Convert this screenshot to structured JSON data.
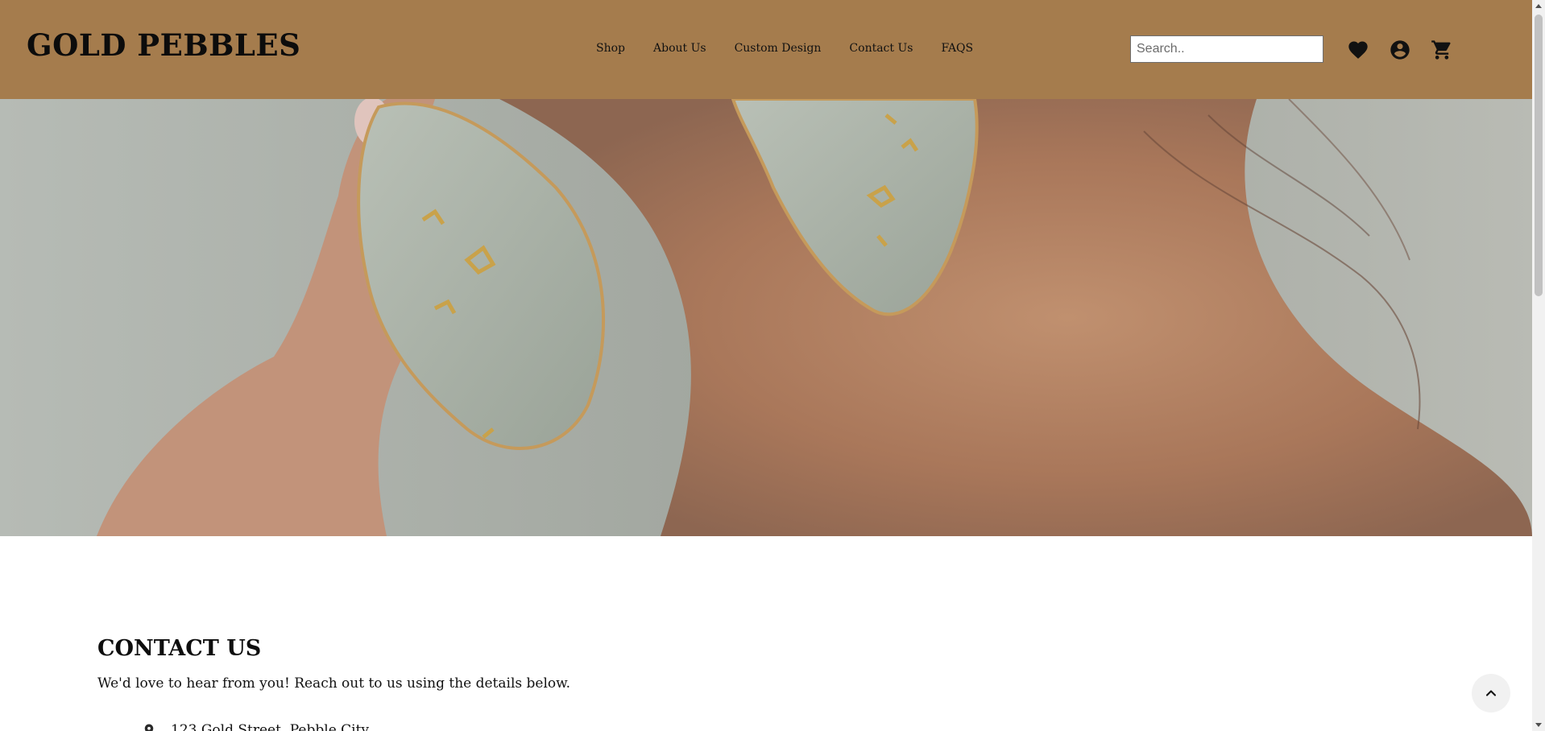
{
  "brand": {
    "name": "GOLD PEBBLES"
  },
  "nav": {
    "items": [
      {
        "label": "Shop"
      },
      {
        "label": "About Us"
      },
      {
        "label": "Custom Design"
      },
      {
        "label": "Contact Us"
      },
      {
        "label": "FAQS"
      }
    ]
  },
  "search": {
    "placeholder": "Search.."
  },
  "header_icons": [
    "heart-icon",
    "account-icon",
    "cart-icon"
  ],
  "contact": {
    "title": "CONTACT US",
    "intro": "We'd love to hear from you! Reach out to us using the details below.",
    "address": "123 Gold Street, Pebble City"
  },
  "colors": {
    "header_bg": "#a57c4d",
    "text": "#111111"
  }
}
